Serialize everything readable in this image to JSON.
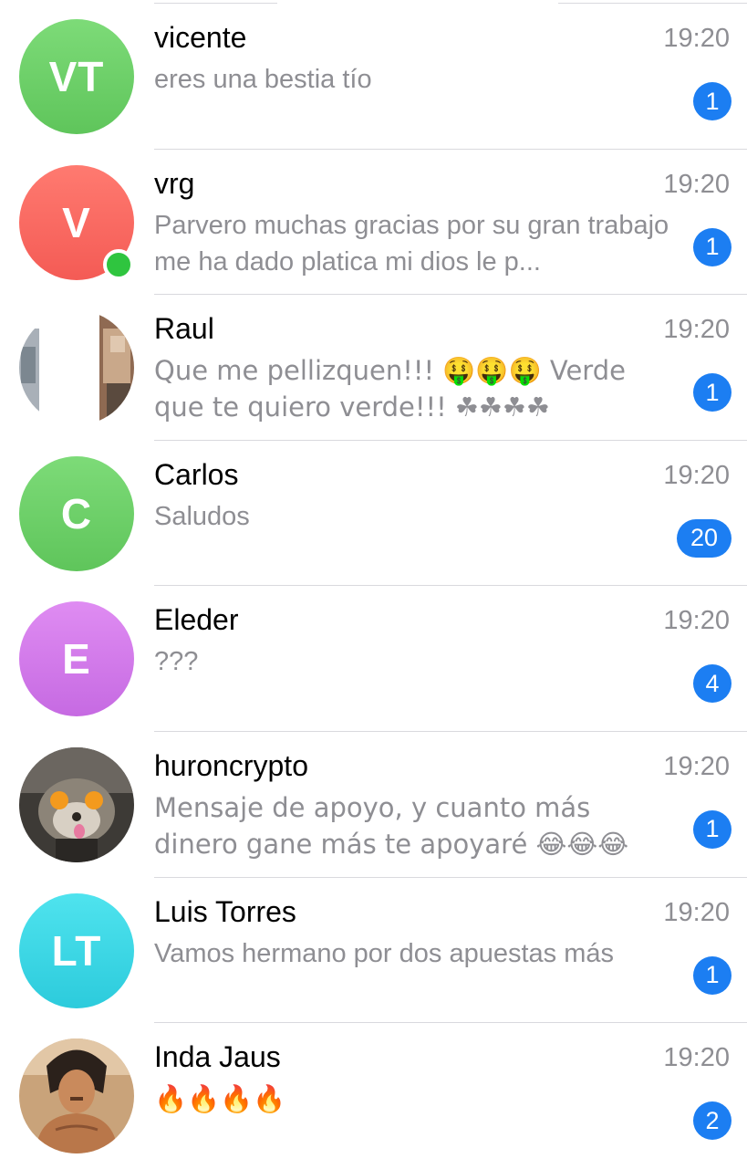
{
  "chats": [
    {
      "name": "vicente",
      "initials": "VT",
      "avatar_color": "#6fd16b",
      "avatar_type": "initials",
      "time": "19:20",
      "preview": "eres una bestia tío",
      "unread": "1",
      "online": false
    },
    {
      "name": "vrg",
      "initials": "V",
      "avatar_color": "#fb6b62",
      "avatar_type": "initials",
      "time": "19:20",
      "preview": "Parvero muchas gracias por su gran trabajo me ha dado platica mi dios le p...",
      "unread": "1",
      "online": true
    },
    {
      "name": "Raul",
      "avatar_type": "photo-street-icon",
      "time": "19:20",
      "preview": "Que me pellizquen!!! 🤑🤑🤑 Verde que te quiero verde!!! ☘☘☘☘",
      "unread": "1",
      "online": false
    },
    {
      "name": "Carlos",
      "initials": "C",
      "avatar_color": "#6fd16b",
      "avatar_type": "initials",
      "time": "19:20",
      "preview": "Saludos",
      "unread": "20",
      "online": false
    },
    {
      "name": "Eleder",
      "initials": "E",
      "avatar_color": "#d17aea",
      "avatar_type": "initials",
      "time": "19:20",
      "preview": "???",
      "unread": "4",
      "online": false
    },
    {
      "name": "huroncrypto",
      "avatar_type": "photo-ferret-icon",
      "time": "19:20",
      "preview": "Mensaje de apoyo, y cuanto más dinero gane más te apoyaré 😂😂😂",
      "unread": "1",
      "online": false
    },
    {
      "name": "Luis Torres",
      "initials": "LT",
      "avatar_color": "#3fd8e6",
      "avatar_type": "initials",
      "time": "19:20",
      "preview": "Vamos hermano por dos apuestas más",
      "unread": "1",
      "online": false
    },
    {
      "name": "Inda Jaus",
      "avatar_type": "photo-warrior-icon",
      "time": "19:20",
      "preview": "🔥🔥🔥🔥",
      "unread": "2",
      "online": false
    }
  ],
  "colors": {
    "accent_badge": "#1c7ef2",
    "online_dot": "#2fc53f",
    "secondary_text": "#8e8e93",
    "separator": "#d9d9de"
  }
}
